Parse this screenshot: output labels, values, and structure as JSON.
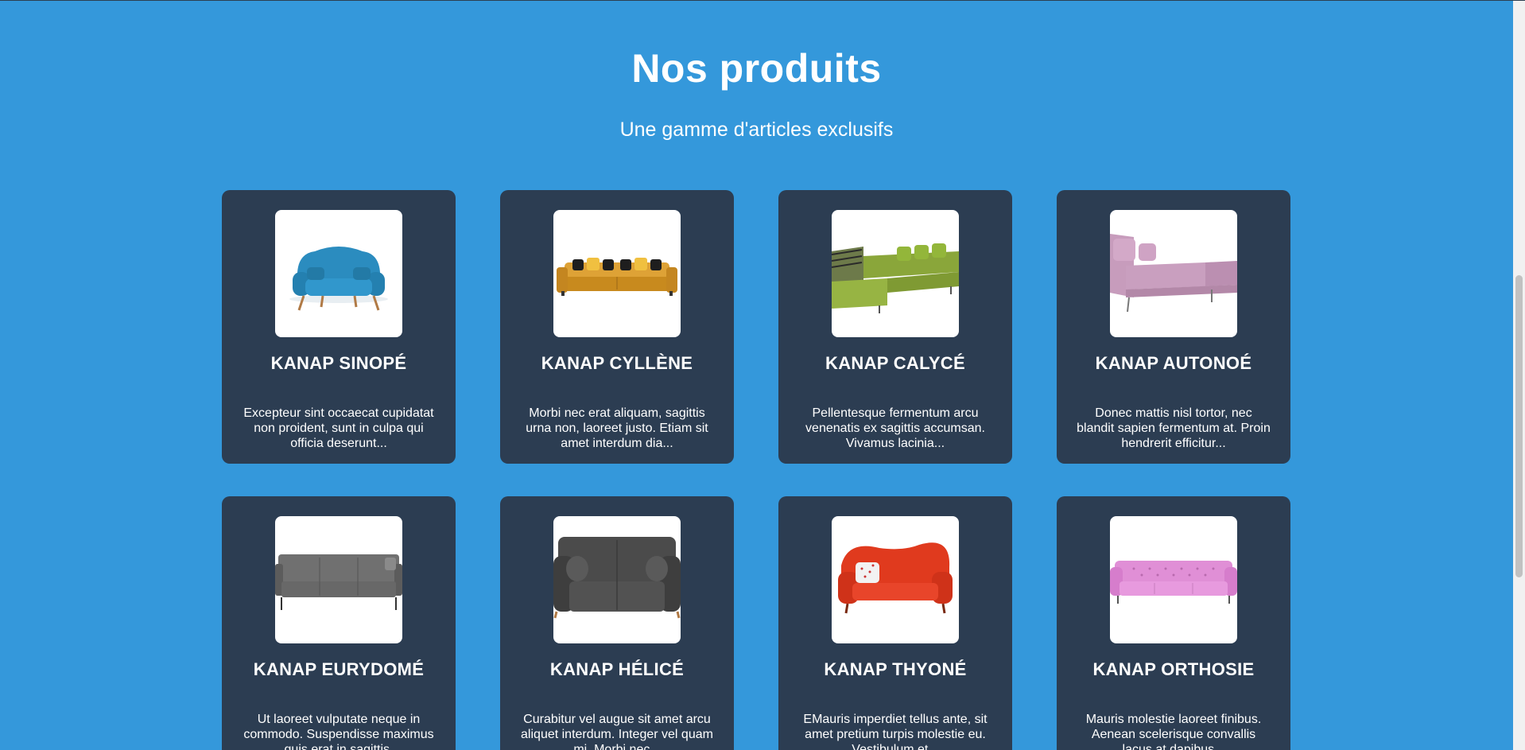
{
  "section": {
    "title": "Nos produits",
    "subtitle": "Une gamme d'articles exclusifs"
  },
  "products": [
    {
      "name": "KANAP SINOPÉ",
      "description": "Excepteur sint occaecat cupidatat non proident, sunt in culpa qui officia deserunt...",
      "image_icon": "blue-sofa-image",
      "color": "#2f8fc0"
    },
    {
      "name": "KANAP CYLLÈNE",
      "description": "Morbi nec erat aliquam, sagittis urna non, laoreet justo. Etiam sit amet interdum dia...",
      "image_icon": "yellow-sofa-image",
      "color": "#d89a2a"
    },
    {
      "name": "KANAP CALYCÉ",
      "description": "Pellentesque fermentum arcu venenatis ex sagittis accumsan. Vivamus lacinia...",
      "image_icon": "green-corner-sofa-image",
      "color": "#8aa83a"
    },
    {
      "name": "KANAP AUTONOÉ",
      "description": "Donec mattis nisl tortor, nec blandit sapien fermentum at. Proin hendrerit efficitur...",
      "image_icon": "pink-chaise-sofa-image",
      "color": "#c7a0bc"
    },
    {
      "name": "KANAP EURYDOMÉ",
      "description": "Ut laoreet vulputate neque in commodo. Suspendisse maximus quis erat in sagittis.",
      "image_icon": "grey-sofa-image",
      "color": "#6a6a6a"
    },
    {
      "name": "KANAP HÉLICÉ",
      "description": "Curabitur vel augue sit amet arcu aliquet interdum. Integer vel quam mi. Morbi nec...",
      "image_icon": "dark-grey-sofa-image",
      "color": "#4a4a4a"
    },
    {
      "name": "KANAP THYONÉ",
      "description": "EMauris imperdiet tellus ante, sit amet pretium turpis molestie eu. Vestibulum et...",
      "image_icon": "red-sofa-image",
      "color": "#e23b1f"
    },
    {
      "name": "KANAP ORTHOSIE",
      "description": "Mauris molestie laoreet finibus. Aenean scelerisque convallis lacus at dapibus...",
      "image_icon": "pink-tufted-sofa-image",
      "color": "#e494d8"
    }
  ],
  "colors": {
    "background": "#3498db",
    "card": "#2c3d52",
    "text": "#ffffff"
  }
}
